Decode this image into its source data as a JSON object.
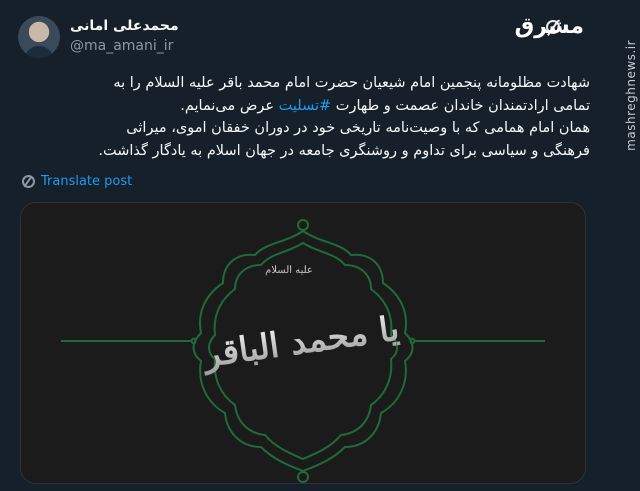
{
  "user": {
    "name": "محمدعلی امانی",
    "handle": "@ma_amani_ir"
  },
  "logo": "مشرق",
  "watermark": "mashreghnews.ir",
  "tweet": {
    "line1": "شهادت مظلومانه پنجمین امام شیعیان حضرت امام محمد باقر علیه السلام را به",
    "line2_before": "تمامی ارادتمندان خاندان عصمت و طهارت ",
    "line2_hashtag": "#تسلیت",
    "line2_after": " عرض می‌نمایم.",
    "line3": "همان امام همامی که با وصیت‌نامه تاریخی خود در دوران خفقان اموی، میراثی",
    "line4": "فرهنگی و سیاسی برای تداوم و روشنگری جامعه در جهان اسلام به یادگار گذاشت."
  },
  "translate_label": "Translate post",
  "media": {
    "calligraphy_main": "یا محمد الباقر",
    "calligraphy_small": "عليه السلام",
    "accent_color": "#1f6b3a"
  },
  "icons": {
    "translate": "globe-icon",
    "logo": "mashregh-logo-icon"
  }
}
